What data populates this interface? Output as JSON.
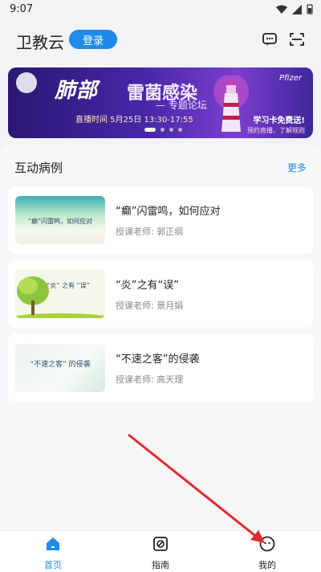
{
  "status": {
    "time": "9:07"
  },
  "header": {
    "title": "卫教云",
    "login_label": "登录"
  },
  "banner": {
    "title_part1": "肺部",
    "title_part2": "雷菌感染",
    "subtitle": "— 专题论坛",
    "date": "直播时间  5月25日 13:30-17:55",
    "brand": "Pfizer",
    "promo": "学习卡免费送!",
    "promo_sub": "预约直播，了解规则"
  },
  "section": {
    "title": "互动病例",
    "more_label": "更多",
    "cases": [
      {
        "title": "“癫”闪雷鸣，如何应对",
        "teacher": "授课老师: 郭正纲",
        "thumb_text": "“癫”闪雷鸣，如何应对"
      },
      {
        "title": "“炎”之有“误”",
        "teacher": "授课老师: 景月娟",
        "thumb_text": "“炎” 之有 “误”"
      },
      {
        "title": "“不速之客”的侵袭",
        "teacher": "授课老师: 高天理",
        "thumb_text": "“不速之客” 的侵袭"
      }
    ]
  },
  "tabbar": {
    "home_label": "首页",
    "guide_label": "指南",
    "mine_label": "我的"
  },
  "colors": {
    "accent": "#1f8be8",
    "annotation_arrow": "#e52a2a"
  }
}
